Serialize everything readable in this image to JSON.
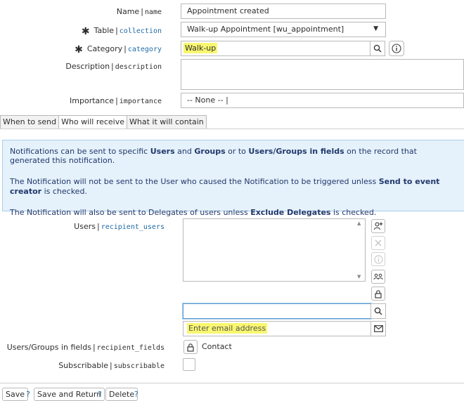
{
  "fields": {
    "name": {
      "label": "Name",
      "field": "name",
      "value": "Appointment created"
    },
    "table": {
      "label": "Table",
      "field": "collection",
      "value": "Walk-up Appointment [wu_appointment]"
    },
    "category": {
      "label": "Category",
      "field": "category",
      "value": "Walk-up"
    },
    "description": {
      "label": "Description",
      "field": "description",
      "value": ""
    },
    "importance": {
      "label": "Importance",
      "field": "importance",
      "value": "-- None -- |"
    },
    "users": {
      "label": "Users",
      "field": "recipient_users",
      "email_placeholder": "Enter email address"
    },
    "groups_in_fields": {
      "label": "Users/Groups in fields",
      "field": "recipient_fields",
      "value": "Contact"
    },
    "subscribable": {
      "label": "Subscribable",
      "field": "subscribable"
    }
  },
  "separator": "|",
  "required_mark": "✱",
  "tabs": [
    {
      "label": "When to send"
    },
    {
      "label": "Who will receive"
    },
    {
      "label": "What it will contain"
    }
  ],
  "info": {
    "p1_a": "Notifications can be sent to specific ",
    "p1_b": "Users",
    "p1_c": " and ",
    "p1_d": "Groups",
    "p1_e": " or to ",
    "p1_f": "Users/Groups in fields",
    "p1_g": " on the record that generated this notification.",
    "p2_a": "The Notification will not be sent to the User who caused the Notification to be triggered unless ",
    "p2_b": "Send to event creator",
    "p2_c": " is checked.",
    "p3_a": "The Notification will also be sent to Delegates of users unless ",
    "p3_b": "Exclude Delegates",
    "p3_c": " is checked."
  },
  "buttons": {
    "save": "Save",
    "save_return": "Save and Return",
    "delete": "Delete",
    "help": "?"
  },
  "icons": {
    "search": "search-icon",
    "info": "info-icon",
    "add_user": "add-user-icon",
    "remove": "close-icon",
    "details": "info-icon",
    "group": "group-icon",
    "lock": "lock-icon",
    "email": "envelope-icon",
    "dropdown": "chevron-down-icon"
  },
  "colors": {
    "highlight": "#f9f770",
    "link": "#1f6aa8",
    "info_bg": "#e5f1fb",
    "info_text": "#21386b",
    "focus": "#5b9bd5"
  }
}
